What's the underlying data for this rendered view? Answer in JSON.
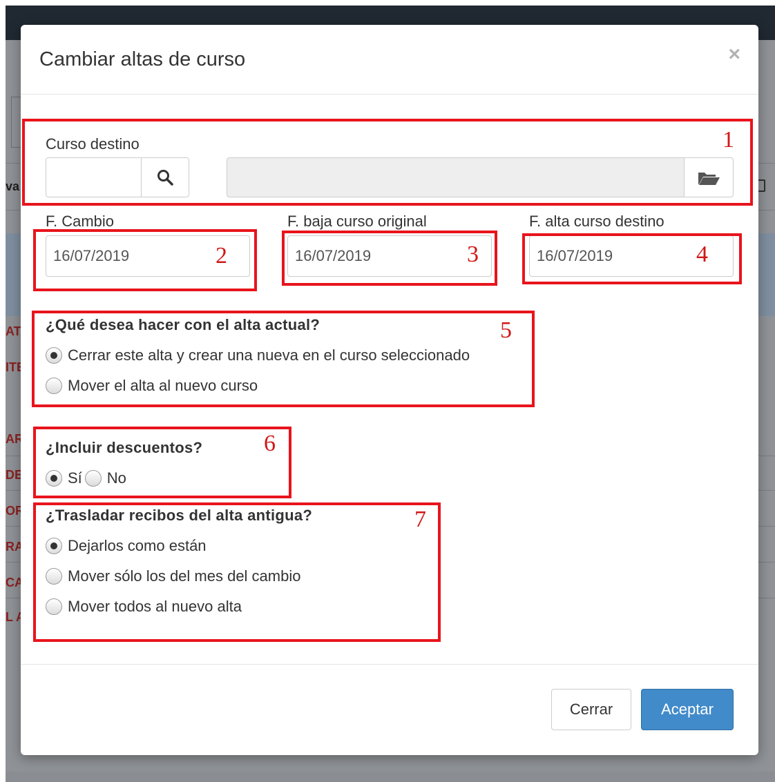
{
  "modal": {
    "title": "Cambiar altas de curso",
    "close_symbol": "×"
  },
  "curso_destino": {
    "label": "Curso destino",
    "code_value": "",
    "name_value": "",
    "search_icon": "search-icon",
    "browse_icon": "folder-open-icon"
  },
  "dates": {
    "f_cambio": {
      "label": "F. Cambio",
      "value": "16/07/2019"
    },
    "f_baja": {
      "label": "F. baja curso original",
      "value": "16/07/2019"
    },
    "f_alta": {
      "label": "F. alta curso destino",
      "value": "16/07/2019"
    }
  },
  "alta_actual": {
    "question": "¿Qué desea hacer con el alta actual?",
    "options": [
      {
        "label": "Cerrar este alta y crear una nueva en el curso seleccionado",
        "checked": true
      },
      {
        "label": "Mover el alta al nuevo curso",
        "checked": false
      }
    ]
  },
  "descuentos": {
    "question": "¿Incluir descuentos?",
    "options": [
      {
        "label": "Sí",
        "checked": true
      },
      {
        "label": "No",
        "checked": false
      }
    ]
  },
  "recibos": {
    "question": "¿Trasladar recibos del alta antigua?",
    "options": [
      {
        "label": "Dejarlos como están",
        "checked": true
      },
      {
        "label": "Mover sólo los del mes del cambio",
        "checked": false
      },
      {
        "label": "Mover todos al nuevo alta",
        "checked": false
      }
    ]
  },
  "footer": {
    "close_label": "Cerrar",
    "accept_label": "Aceptar"
  },
  "annotations": [
    "1",
    "2",
    "3",
    "4",
    "5",
    "6",
    "7"
  ],
  "background": {
    "partial_texts": [
      "va",
      "ATI",
      "ITE",
      "AR",
      "DE",
      "OR",
      "RA",
      "CA",
      "L A"
    ]
  },
  "colors": {
    "primary": "#428bca",
    "annotation": "#e8141c",
    "topbar": "#202831"
  }
}
